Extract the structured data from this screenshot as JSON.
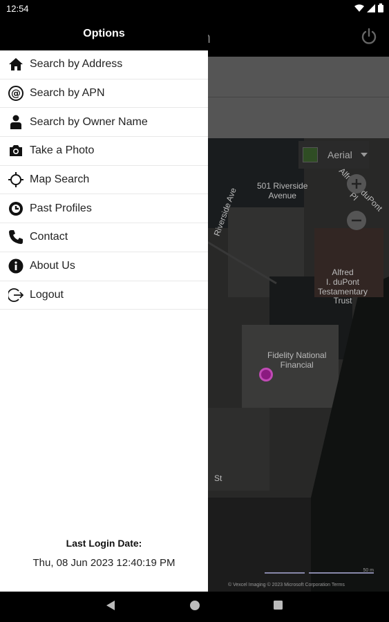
{
  "status": {
    "time": "12:54"
  },
  "appbar": {
    "title": "earch"
  },
  "drawer": {
    "title": "Options",
    "items": [
      {
        "label": "Search by Address",
        "icon": "home-icon"
      },
      {
        "label": "Search by APN",
        "icon": "at-sign-icon"
      },
      {
        "label": "Search by Owner Name",
        "icon": "person-icon"
      },
      {
        "label": "Take a Photo",
        "icon": "camera-icon"
      },
      {
        "label": "Map Search",
        "icon": "crosshair-icon"
      },
      {
        "label": "Past Profiles",
        "icon": "history-icon"
      },
      {
        "label": "Contact",
        "icon": "phone-icon"
      },
      {
        "label": "About Us",
        "icon": "info-icon"
      },
      {
        "label": "Logout",
        "icon": "logout-icon"
      }
    ],
    "last_login_label": "Last Login Date:",
    "last_login_value": "Thu, 08 Jun 2023 12:40:19 PM"
  },
  "map": {
    "layer_label": "Aerial",
    "labels": {
      "riverside": "501 Riverside\nAvenue",
      "alfred": "Alfred\nI. duPont\nTestamentary\nTrust",
      "fidelity": "Fidelity National\nFinancial",
      "road1": "Alfred I. duPont Pl",
      "road2": "Riverside Ave",
      "road3": "St"
    },
    "copyright": "© Vexcel Imaging © 2023 Microsoft Corporation  Terms",
    "scale_label": "50 m"
  }
}
